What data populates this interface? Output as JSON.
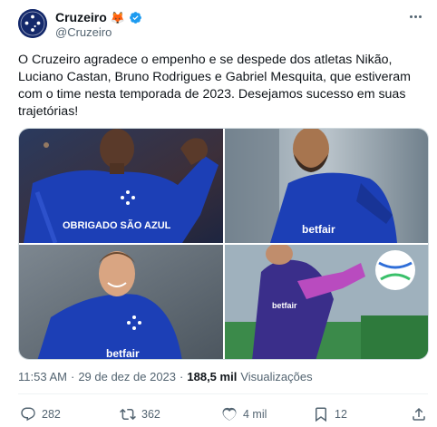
{
  "author": {
    "name": "Cruzeiro",
    "emoji": "🦊",
    "handle": "@Cruzeiro"
  },
  "icons": {
    "avatar": "cruzeiro-crest-icon",
    "verified": "verified-badge-icon",
    "more": "more-options-icon",
    "reply": "reply-icon",
    "retweet": "retweet-icon",
    "like": "heart-icon",
    "bookmark": "bookmark-icon",
    "share": "share-icon"
  },
  "colors": {
    "verified": "#1d9bf0",
    "kit_blue": "#1c3fb6",
    "text": "#0f1419",
    "muted": "#536471"
  },
  "tweet": {
    "text": "O Cruzeiro agradece o empenho e se despede dos atletas Nikão, Luciano Castan, Bruno Rodrigues e Gabriel Mesquita, que estiveram com o time nesta temporada de 2023. Desejamos sucesso em suas trajetórias!",
    "time": "11:53 AM",
    "separator": "·",
    "date": "29 de dez de 2023",
    "views_count": "188,5 mil",
    "views_label": "Visualizações"
  },
  "photos": {
    "p1_sponsor": "OBRIGADO SÃO AZUL",
    "p2_sponsor": "betfair",
    "p3_sponsor": "betfair",
    "p4_sponsor": "betfair"
  },
  "actions": {
    "replies": "282",
    "retweets": "362",
    "likes": "4 mil",
    "bookmarks": "12"
  }
}
